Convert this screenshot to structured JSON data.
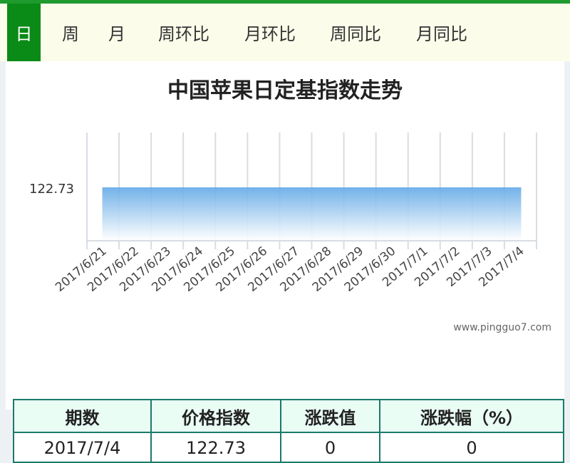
{
  "tabs": [
    {
      "label": "日",
      "active": true
    },
    {
      "label": "周",
      "active": false
    },
    {
      "label": "月",
      "active": false
    },
    {
      "label": "周环比",
      "active": false
    },
    {
      "label": "月环比",
      "active": false
    },
    {
      "label": "周同比",
      "active": false
    },
    {
      "label": "月同比",
      "active": false
    }
  ],
  "watermark": "www.pingguo7.com",
  "chart_data": {
    "type": "area",
    "title": "中国苹果日定基指数走势",
    "x": [
      "2017/6/21",
      "2017/6/22",
      "2017/6/23",
      "2017/6/24",
      "2017/6/25",
      "2017/6/26",
      "2017/6/27",
      "2017/6/28",
      "2017/6/29",
      "2017/6/30",
      "2017/7/1",
      "2017/7/2",
      "2017/7/3",
      "2017/7/4"
    ],
    "series": [
      {
        "values": [
          122.73,
          122.73,
          122.73,
          122.73,
          122.73,
          122.73,
          122.73,
          122.73,
          122.73,
          122.73,
          122.73,
          122.73,
          122.73,
          122.73
        ]
      }
    ],
    "ytick_labels": [
      "122.73"
    ],
    "grid": "vertical",
    "color": "#6ab0e8"
  },
  "table": {
    "headers": [
      "期数",
      "价格指数",
      "涨跌值",
      "涨跌幅（%）"
    ],
    "rows": [
      [
        "2017/7/4",
        "122.73",
        "0",
        "0"
      ]
    ]
  }
}
